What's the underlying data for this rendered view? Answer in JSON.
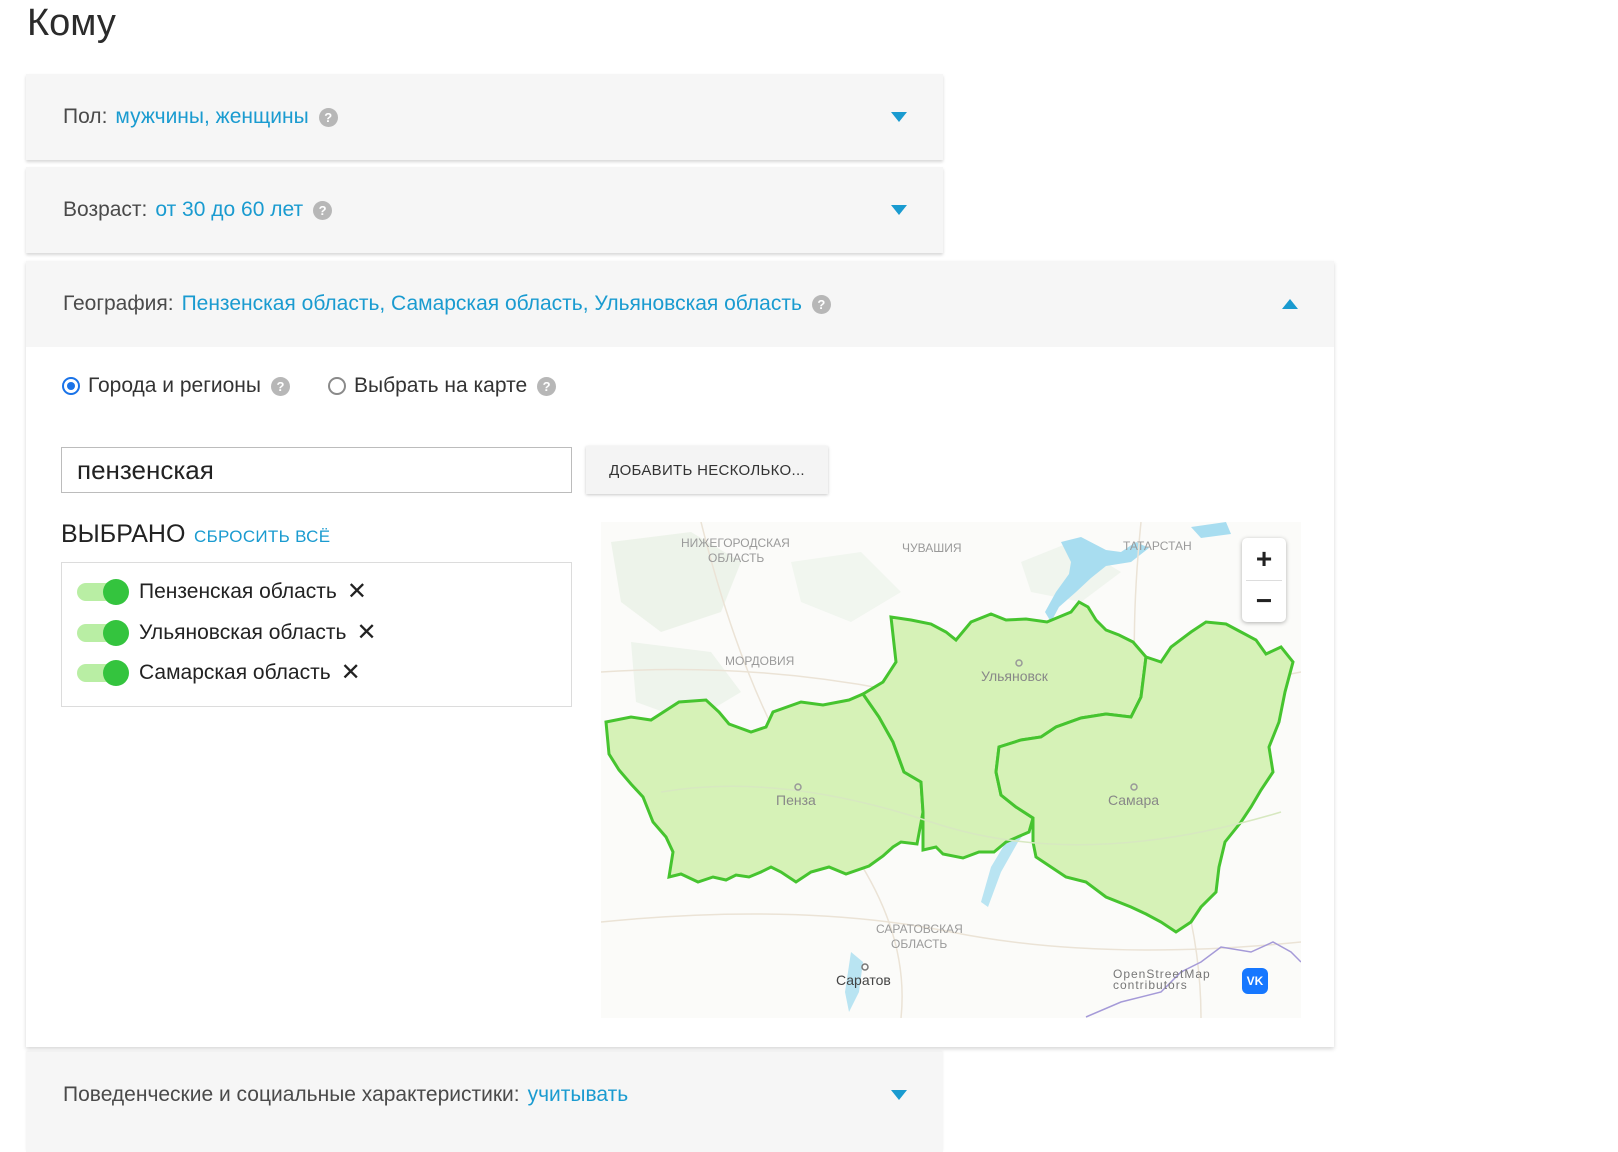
{
  "page": {
    "title": "Кому"
  },
  "gender": {
    "label": "Пол:",
    "value": "мужчины, женщины",
    "help": "?"
  },
  "age": {
    "label": "Возраст:",
    "value": "от 30 до 60 лет",
    "help": "?"
  },
  "geography": {
    "label": "География:",
    "value": "Пензенская область, Самарская область, Ульяновская область",
    "help": "?",
    "radio_options": [
      {
        "label": "Города и регионы",
        "selected": true
      },
      {
        "label": "Выбрать на карте",
        "selected": false
      }
    ],
    "search_value": "пензенская",
    "add_button": "ДОБАВИТЬ НЕСКОЛЬКО...",
    "selected_title": "ВЫБРАНО",
    "reset_link": "СБРОСИТЬ ВСЁ",
    "selected_regions": [
      {
        "name": "Пензенская область",
        "enabled": true
      },
      {
        "name": "Ульяновская область",
        "enabled": true
      },
      {
        "name": "Самарская область",
        "enabled": true
      }
    ],
    "map": {
      "zoom_in": "+",
      "zoom_out": "−",
      "labels": [
        "НИЖЕГОРОДСКАЯ",
        "ОБЛАСТЬ",
        "ЧУВАШИЯ",
        "ТАТАРСТАН",
        "МОРДОВИЯ",
        "Ульяновск",
        "Пенза",
        "Самара",
        "САРАТОВСКАЯ",
        "ОБЛАСТЬ",
        "Саратов"
      ],
      "attribution_line1": "OpenStreetMap",
      "attribution_line2": "contributors",
      "vk_badge": "VK",
      "highlight_color": "#d6f2b7",
      "border_color": "#46c42f"
    }
  },
  "behavior": {
    "label": "Поведенческие и социальные характеристики:",
    "value": "учитывать"
  },
  "colors": {
    "link": "#1a9bd0",
    "toggle_on": "#34c43e",
    "radio_on": "#1a73e8"
  }
}
